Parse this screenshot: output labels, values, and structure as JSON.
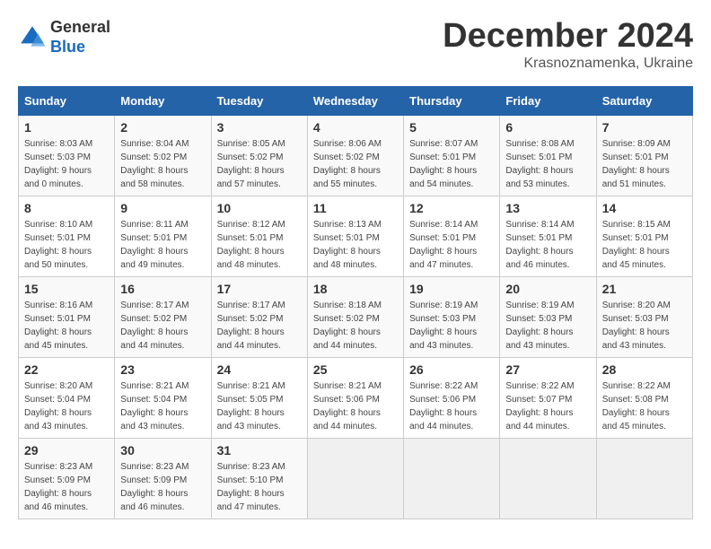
{
  "header": {
    "logo_line1": "General",
    "logo_line2": "Blue",
    "month": "December 2024",
    "location": "Krasnoznamenka, Ukraine"
  },
  "weekdays": [
    "Sunday",
    "Monday",
    "Tuesday",
    "Wednesday",
    "Thursday",
    "Friday",
    "Saturday"
  ],
  "weeks": [
    [
      {
        "day": "1",
        "sunrise": "Sunrise: 8:03 AM",
        "sunset": "Sunset: 5:03 PM",
        "daylight": "Daylight: 9 hours and 0 minutes."
      },
      {
        "day": "2",
        "sunrise": "Sunrise: 8:04 AM",
        "sunset": "Sunset: 5:02 PM",
        "daylight": "Daylight: 8 hours and 58 minutes."
      },
      {
        "day": "3",
        "sunrise": "Sunrise: 8:05 AM",
        "sunset": "Sunset: 5:02 PM",
        "daylight": "Daylight: 8 hours and 57 minutes."
      },
      {
        "day": "4",
        "sunrise": "Sunrise: 8:06 AM",
        "sunset": "Sunset: 5:02 PM",
        "daylight": "Daylight: 8 hours and 55 minutes."
      },
      {
        "day": "5",
        "sunrise": "Sunrise: 8:07 AM",
        "sunset": "Sunset: 5:01 PM",
        "daylight": "Daylight: 8 hours and 54 minutes."
      },
      {
        "day": "6",
        "sunrise": "Sunrise: 8:08 AM",
        "sunset": "Sunset: 5:01 PM",
        "daylight": "Daylight: 8 hours and 53 minutes."
      },
      {
        "day": "7",
        "sunrise": "Sunrise: 8:09 AM",
        "sunset": "Sunset: 5:01 PM",
        "daylight": "Daylight: 8 hours and 51 minutes."
      }
    ],
    [
      {
        "day": "8",
        "sunrise": "Sunrise: 8:10 AM",
        "sunset": "Sunset: 5:01 PM",
        "daylight": "Daylight: 8 hours and 50 minutes."
      },
      {
        "day": "9",
        "sunrise": "Sunrise: 8:11 AM",
        "sunset": "Sunset: 5:01 PM",
        "daylight": "Daylight: 8 hours and 49 minutes."
      },
      {
        "day": "10",
        "sunrise": "Sunrise: 8:12 AM",
        "sunset": "Sunset: 5:01 PM",
        "daylight": "Daylight: 8 hours and 48 minutes."
      },
      {
        "day": "11",
        "sunrise": "Sunrise: 8:13 AM",
        "sunset": "Sunset: 5:01 PM",
        "daylight": "Daylight: 8 hours and 48 minutes."
      },
      {
        "day": "12",
        "sunrise": "Sunrise: 8:14 AM",
        "sunset": "Sunset: 5:01 PM",
        "daylight": "Daylight: 8 hours and 47 minutes."
      },
      {
        "day": "13",
        "sunrise": "Sunrise: 8:14 AM",
        "sunset": "Sunset: 5:01 PM",
        "daylight": "Daylight: 8 hours and 46 minutes."
      },
      {
        "day": "14",
        "sunrise": "Sunrise: 8:15 AM",
        "sunset": "Sunset: 5:01 PM",
        "daylight": "Daylight: 8 hours and 45 minutes."
      }
    ],
    [
      {
        "day": "15",
        "sunrise": "Sunrise: 8:16 AM",
        "sunset": "Sunset: 5:01 PM",
        "daylight": "Daylight: 8 hours and 45 minutes."
      },
      {
        "day": "16",
        "sunrise": "Sunrise: 8:17 AM",
        "sunset": "Sunset: 5:02 PM",
        "daylight": "Daylight: 8 hours and 44 minutes."
      },
      {
        "day": "17",
        "sunrise": "Sunrise: 8:17 AM",
        "sunset": "Sunset: 5:02 PM",
        "daylight": "Daylight: 8 hours and 44 minutes."
      },
      {
        "day": "18",
        "sunrise": "Sunrise: 8:18 AM",
        "sunset": "Sunset: 5:02 PM",
        "daylight": "Daylight: 8 hours and 44 minutes."
      },
      {
        "day": "19",
        "sunrise": "Sunrise: 8:19 AM",
        "sunset": "Sunset: 5:03 PM",
        "daylight": "Daylight: 8 hours and 43 minutes."
      },
      {
        "day": "20",
        "sunrise": "Sunrise: 8:19 AM",
        "sunset": "Sunset: 5:03 PM",
        "daylight": "Daylight: 8 hours and 43 minutes."
      },
      {
        "day": "21",
        "sunrise": "Sunrise: 8:20 AM",
        "sunset": "Sunset: 5:03 PM",
        "daylight": "Daylight: 8 hours and 43 minutes."
      }
    ],
    [
      {
        "day": "22",
        "sunrise": "Sunrise: 8:20 AM",
        "sunset": "Sunset: 5:04 PM",
        "daylight": "Daylight: 8 hours and 43 minutes."
      },
      {
        "day": "23",
        "sunrise": "Sunrise: 8:21 AM",
        "sunset": "Sunset: 5:04 PM",
        "daylight": "Daylight: 8 hours and 43 minutes."
      },
      {
        "day": "24",
        "sunrise": "Sunrise: 8:21 AM",
        "sunset": "Sunset: 5:05 PM",
        "daylight": "Daylight: 8 hours and 43 minutes."
      },
      {
        "day": "25",
        "sunrise": "Sunrise: 8:21 AM",
        "sunset": "Sunset: 5:06 PM",
        "daylight": "Daylight: 8 hours and 44 minutes."
      },
      {
        "day": "26",
        "sunrise": "Sunrise: 8:22 AM",
        "sunset": "Sunset: 5:06 PM",
        "daylight": "Daylight: 8 hours and 44 minutes."
      },
      {
        "day": "27",
        "sunrise": "Sunrise: 8:22 AM",
        "sunset": "Sunset: 5:07 PM",
        "daylight": "Daylight: 8 hours and 44 minutes."
      },
      {
        "day": "28",
        "sunrise": "Sunrise: 8:22 AM",
        "sunset": "Sunset: 5:08 PM",
        "daylight": "Daylight: 8 hours and 45 minutes."
      }
    ],
    [
      {
        "day": "29",
        "sunrise": "Sunrise: 8:23 AM",
        "sunset": "Sunset: 5:09 PM",
        "daylight": "Daylight: 8 hours and 46 minutes."
      },
      {
        "day": "30",
        "sunrise": "Sunrise: 8:23 AM",
        "sunset": "Sunset: 5:09 PM",
        "daylight": "Daylight: 8 hours and 46 minutes."
      },
      {
        "day": "31",
        "sunrise": "Sunrise: 8:23 AM",
        "sunset": "Sunset: 5:10 PM",
        "daylight": "Daylight: 8 hours and 47 minutes."
      },
      null,
      null,
      null,
      null
    ]
  ]
}
